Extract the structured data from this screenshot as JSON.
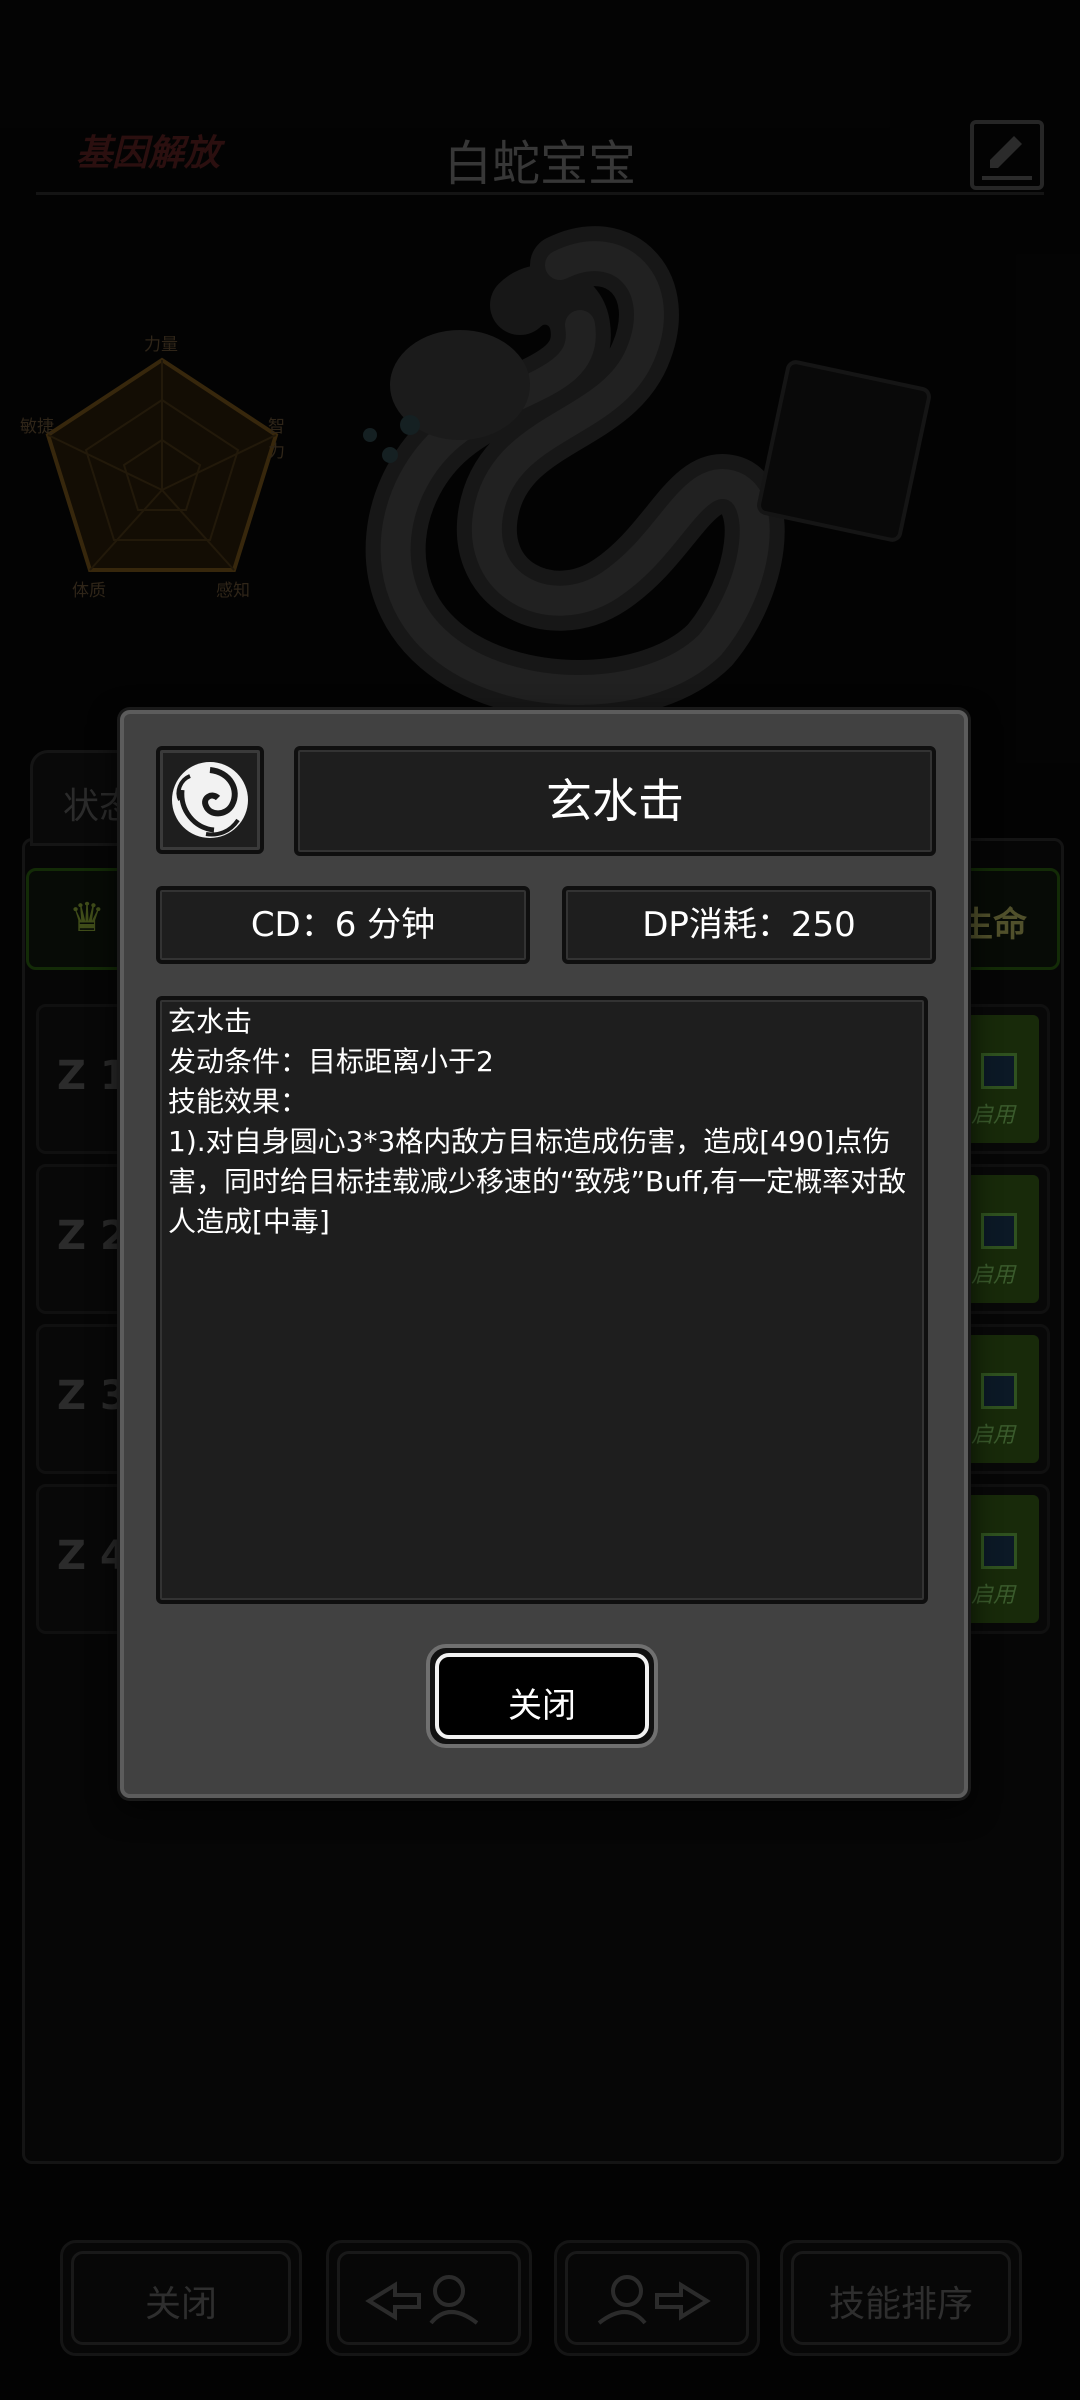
{
  "background": {
    "logo_text": "基因解放",
    "pet_name": "白蛇宝宝",
    "radar": {
      "strength": "力量",
      "intelligence": "智力",
      "perception": "感知",
      "physique": "体质",
      "agility": "敏捷"
    },
    "tab_label": "状态",
    "life_label": "生命",
    "skill_slots": [
      {
        "label": "1",
        "enable_label": "启用"
      },
      {
        "label": "2",
        "enable_label": "启用"
      },
      {
        "label": "3",
        "enable_label": "启用"
      },
      {
        "label": "4",
        "enable_label": "启用"
      }
    ],
    "buttons": {
      "close": "关闭",
      "sort_skills": "技能排序"
    }
  },
  "dialog": {
    "skill_name": "玄水击",
    "cd_text": "CD：6 分钟",
    "dp_text": "DP消耗：250",
    "description": {
      "line1": "玄水击",
      "line2": "发动条件：目标距离小于2",
      "line3": "技能效果：",
      "line4": "1).对自身圆心3*3格内敌方目标造成伤害，造成[490]点伤害，同时给目标挂载减少移速的“致残”Buff,有一定概率对敌人造成[中毒]"
    },
    "close_button": "关闭"
  },
  "colors": {
    "dialog_bg": "#414141",
    "box_bg": "#1e1e1e",
    "text": "#ffffff",
    "enable_green": "#20380e"
  }
}
